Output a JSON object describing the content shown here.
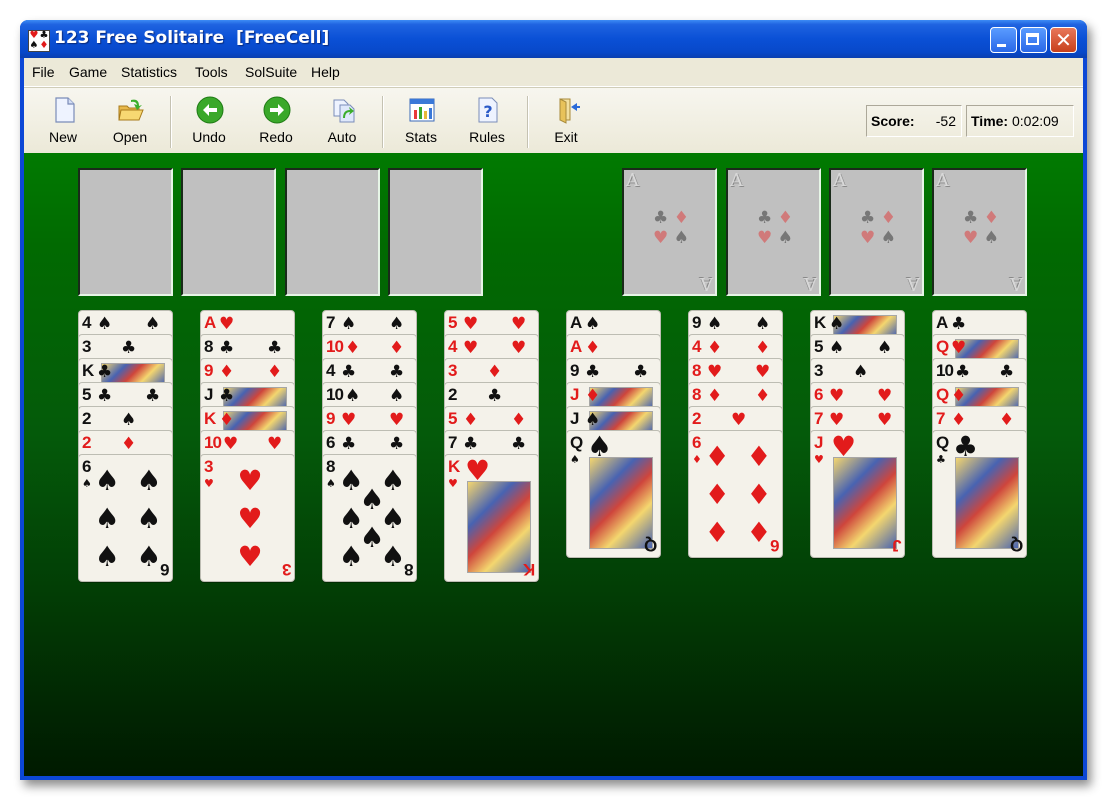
{
  "window": {
    "title": "123 Free Solitaire  [FreeCell]",
    "app_icon_suits": [
      "♥",
      "♣",
      "♠",
      "♦"
    ]
  },
  "menu": [
    "File",
    "Game",
    "Statistics",
    "Tools",
    "SolSuite",
    "Help"
  ],
  "toolbar": {
    "buttons": [
      {
        "label": "New",
        "icon": "new-document-icon"
      },
      {
        "label": "Open",
        "icon": "open-folder-icon"
      },
      {
        "label": "Undo",
        "icon": "undo-arrow-icon"
      },
      {
        "label": "Redo",
        "icon": "redo-arrow-icon"
      },
      {
        "label": "Auto",
        "icon": "auto-play-icon"
      },
      {
        "label": "Stats",
        "icon": "stats-chart-icon"
      },
      {
        "label": "Rules",
        "icon": "rules-help-icon"
      },
      {
        "label": "Exit",
        "icon": "exit-door-icon"
      }
    ],
    "score_label": "Score:",
    "score_value": "-52",
    "time_label": "Time:",
    "time_value": "0:02:09"
  },
  "game": {
    "free_cells": [
      null,
      null,
      null,
      null
    ],
    "foundations": [
      {
        "placeholder": "A",
        "suits": [
          "♣",
          "♦",
          "♥",
          "♠"
        ]
      },
      {
        "placeholder": "A",
        "suits": [
          "♣",
          "♦",
          "♥",
          "♠"
        ]
      },
      {
        "placeholder": "A",
        "suits": [
          "♣",
          "♦",
          "♥",
          "♠"
        ]
      },
      {
        "placeholder": "A",
        "suits": [
          "♣",
          "♦",
          "♥",
          "♠"
        ]
      }
    ],
    "tableau": [
      [
        {
          "r": "4",
          "s": "♠"
        },
        {
          "r": "3",
          "s": "♣"
        },
        {
          "r": "K",
          "s": "♣"
        },
        {
          "r": "5",
          "s": "♣"
        },
        {
          "r": "2",
          "s": "♠"
        },
        {
          "r": "2",
          "s": "♦"
        },
        {
          "r": "6",
          "s": "♠"
        }
      ],
      [
        {
          "r": "A",
          "s": "♥"
        },
        {
          "r": "8",
          "s": "♣"
        },
        {
          "r": "9",
          "s": "♦"
        },
        {
          "r": "J",
          "s": "♣"
        },
        {
          "r": "K",
          "s": "♦"
        },
        {
          "r": "10",
          "s": "♥"
        },
        {
          "r": "3",
          "s": "♥"
        }
      ],
      [
        {
          "r": "7",
          "s": "♠"
        },
        {
          "r": "10",
          "s": "♦"
        },
        {
          "r": "4",
          "s": "♣"
        },
        {
          "r": "10",
          "s": "♠"
        },
        {
          "r": "9",
          "s": "♥"
        },
        {
          "r": "6",
          "s": "♣"
        },
        {
          "r": "8",
          "s": "♠"
        }
      ],
      [
        {
          "r": "5",
          "s": "♥"
        },
        {
          "r": "4",
          "s": "♥"
        },
        {
          "r": "3",
          "s": "♦"
        },
        {
          "r": "2",
          "s": "♣"
        },
        {
          "r": "5",
          "s": "♦"
        },
        {
          "r": "7",
          "s": "♣"
        },
        {
          "r": "K",
          "s": "♥"
        }
      ],
      [
        {
          "r": "A",
          "s": "♠"
        },
        {
          "r": "A",
          "s": "♦"
        },
        {
          "r": "9",
          "s": "♣"
        },
        {
          "r": "J",
          "s": "♦"
        },
        {
          "r": "J",
          "s": "♠"
        },
        {
          "r": "Q",
          "s": "♠"
        }
      ],
      [
        {
          "r": "9",
          "s": "♠"
        },
        {
          "r": "4",
          "s": "♦"
        },
        {
          "r": "8",
          "s": "♥"
        },
        {
          "r": "8",
          "s": "♦"
        },
        {
          "r": "2",
          "s": "♥"
        },
        {
          "r": "6",
          "s": "♦"
        }
      ],
      [
        {
          "r": "K",
          "s": "♠"
        },
        {
          "r": "5",
          "s": "♠"
        },
        {
          "r": "3",
          "s": "♠"
        },
        {
          "r": "6",
          "s": "♥"
        },
        {
          "r": "7",
          "s": "♥"
        },
        {
          "r": "J",
          "s": "♥"
        }
      ],
      [
        {
          "r": "A",
          "s": "♣"
        },
        {
          "r": "Q",
          "s": "♥"
        },
        {
          "r": "10",
          "s": "♣"
        },
        {
          "r": "Q",
          "s": "♦"
        },
        {
          "r": "7",
          "s": "♦"
        },
        {
          "r": "Q",
          "s": "♣"
        }
      ]
    ]
  },
  "colors": {
    "felt": "#017a01",
    "title_bar": "#0a50d6",
    "card_red": "#e21b1b",
    "card_black": "#111111",
    "slot_gray": "#c0c0c0"
  }
}
